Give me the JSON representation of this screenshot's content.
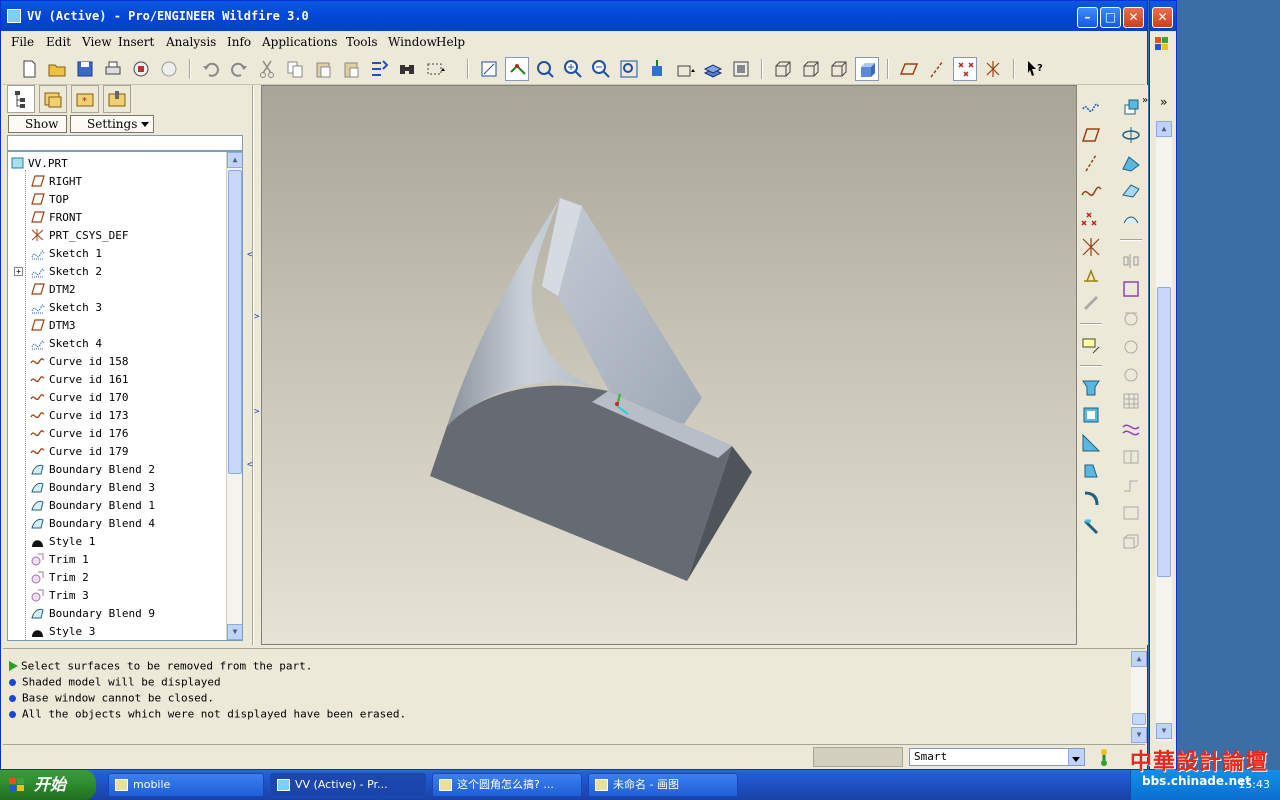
{
  "window": {
    "title": "VV (Active) - Pro/ENGINEER Wildfire 3.0",
    "min_glyph": "–",
    "max_glyph": "□",
    "close_glyph": "✕"
  },
  "menu": [
    "File",
    "Edit",
    "View",
    "Insert",
    "Analysis",
    "Info",
    "Applications",
    "Tools",
    "Window",
    "Help"
  ],
  "left_panel": {
    "show_label": "Show",
    "settings_label": "Settings"
  },
  "tree": {
    "root": "VV.PRT",
    "items": [
      {
        "label": "RIGHT",
        "icon": "datum-plane-icon"
      },
      {
        "label": "TOP",
        "icon": "datum-plane-icon"
      },
      {
        "label": "FRONT",
        "icon": "datum-plane-icon"
      },
      {
        "label": "PRT_CSYS_DEF",
        "icon": "coordinate-system-icon"
      },
      {
        "label": "Sketch 1",
        "icon": "sketch-icon"
      },
      {
        "label": "Sketch 2",
        "icon": "sketch-icon"
      },
      {
        "label": "DTM2",
        "icon": "datum-plane-icon"
      },
      {
        "label": "Sketch 3",
        "icon": "sketch-icon"
      },
      {
        "label": "DTM3",
        "icon": "datum-plane-icon"
      },
      {
        "label": "Sketch 4",
        "icon": "sketch-icon"
      },
      {
        "label": "Curve id 158",
        "icon": "curve-icon"
      },
      {
        "label": "Curve id 161",
        "icon": "curve-icon"
      },
      {
        "label": "Curve id 170",
        "icon": "curve-icon"
      },
      {
        "label": "Curve id 173",
        "icon": "curve-icon"
      },
      {
        "label": "Curve id 176",
        "icon": "curve-icon"
      },
      {
        "label": "Curve id 179",
        "icon": "curve-icon"
      },
      {
        "label": "Boundary Blend 2",
        "icon": "boundary-blend-icon"
      },
      {
        "label": "Boundary Blend 3",
        "icon": "boundary-blend-icon"
      },
      {
        "label": "Boundary Blend 1",
        "icon": "boundary-blend-icon"
      },
      {
        "label": "Boundary Blend 4",
        "icon": "boundary-blend-icon"
      },
      {
        "label": "Style 1",
        "icon": "style-icon"
      },
      {
        "label": "Trim 1",
        "icon": "trim-icon"
      },
      {
        "label": "Trim 2",
        "icon": "trim-icon"
      },
      {
        "label": "Trim 3",
        "icon": "trim-icon"
      },
      {
        "label": "Boundary Blend 9",
        "icon": "boundary-blend-icon"
      },
      {
        "label": "Style 3",
        "icon": "style-icon"
      }
    ]
  },
  "messages": [
    {
      "text": "Select surfaces to be removed from the part.",
      "type": "prompt"
    },
    {
      "text": "Shaded model will be displayed",
      "type": "info"
    },
    {
      "text": "Base window cannot be closed.",
      "type": "info"
    },
    {
      "text": "All the objects which were not displayed have been erased.",
      "type": "info"
    }
  ],
  "status": {
    "filter_value": "Smart"
  },
  "taskbar": {
    "start_label": "开始",
    "tasks": [
      "mobile",
      "VV (Active) - Pr...",
      "这个圆角怎么搞? ...",
      "未命名 - 画图"
    ],
    "clock": "15:43"
  },
  "watermark": {
    "title": "中華設計論壇",
    "url": "bbs.chinade.net"
  },
  "colors": {
    "titlebar": "#0349d6",
    "model_light": "#a9b2bd",
    "model_dark": "#666b73",
    "accent_prompt": "#28a028"
  }
}
